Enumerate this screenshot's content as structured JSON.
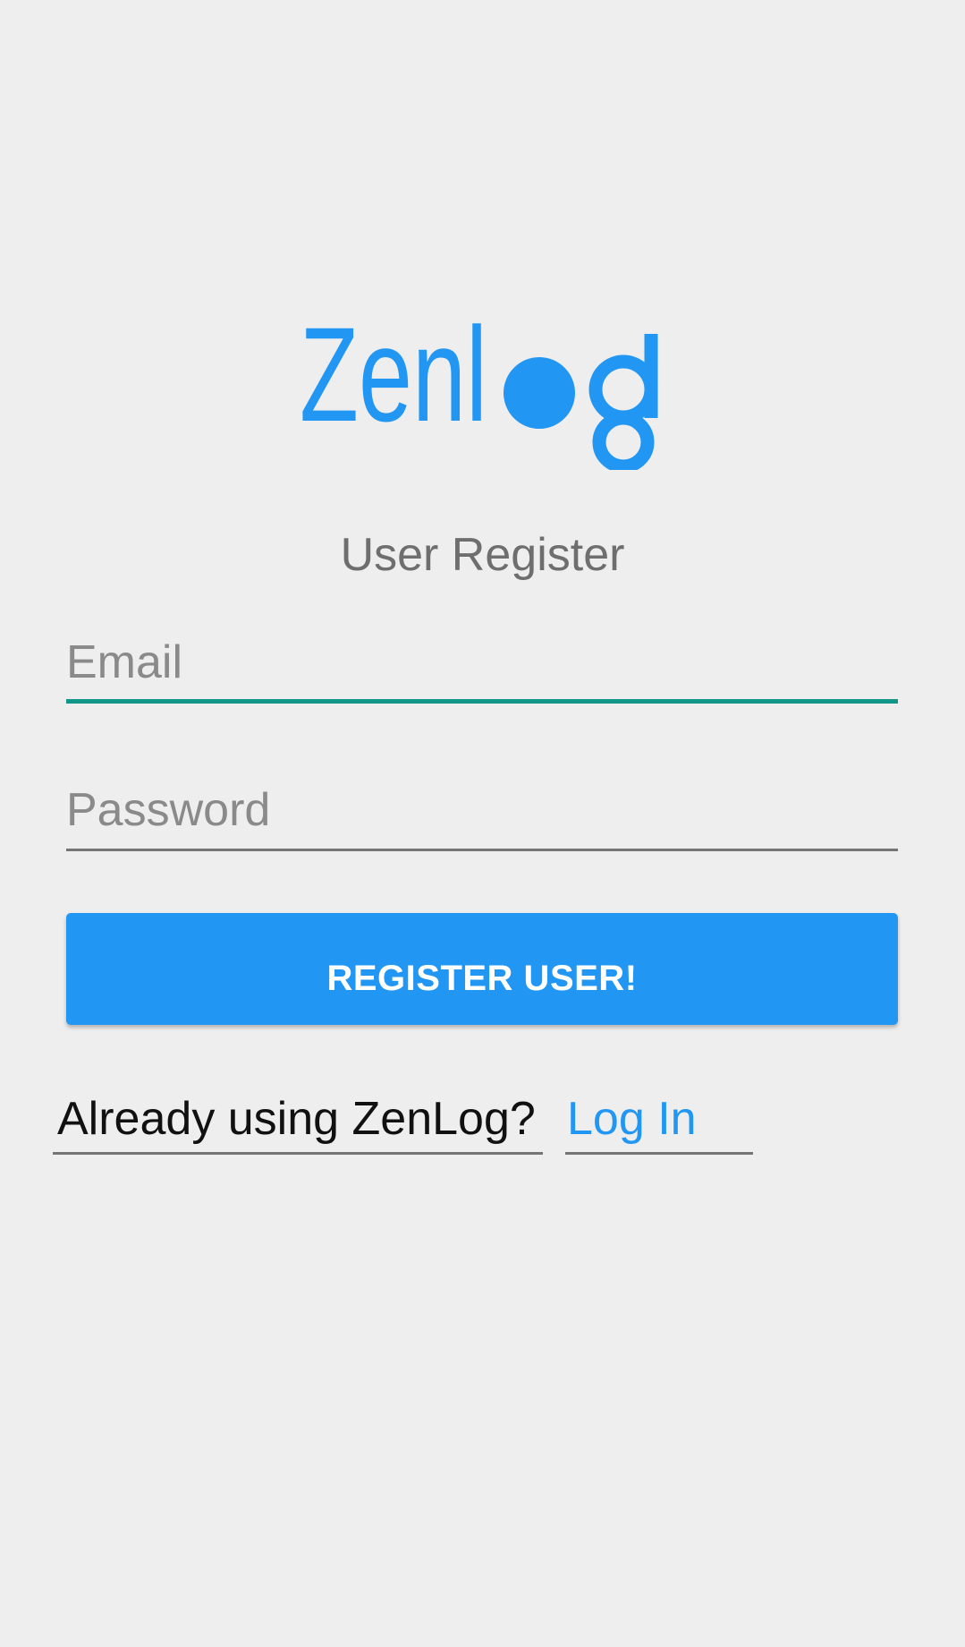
{
  "logo": {
    "text_before_o": "Zenl",
    "text_after_o": "g",
    "color": "#2196f3"
  },
  "heading": "User Register",
  "email": {
    "placeholder": "Email",
    "value": ""
  },
  "password": {
    "placeholder": "Password",
    "value": ""
  },
  "register_button": "REGISTER USER!",
  "already_text": "Already using ZenLog?",
  "login_link": "Log In",
  "colors": {
    "background": "#eeeeee",
    "accent": "#2196f3",
    "focus_underline": "#129688"
  }
}
